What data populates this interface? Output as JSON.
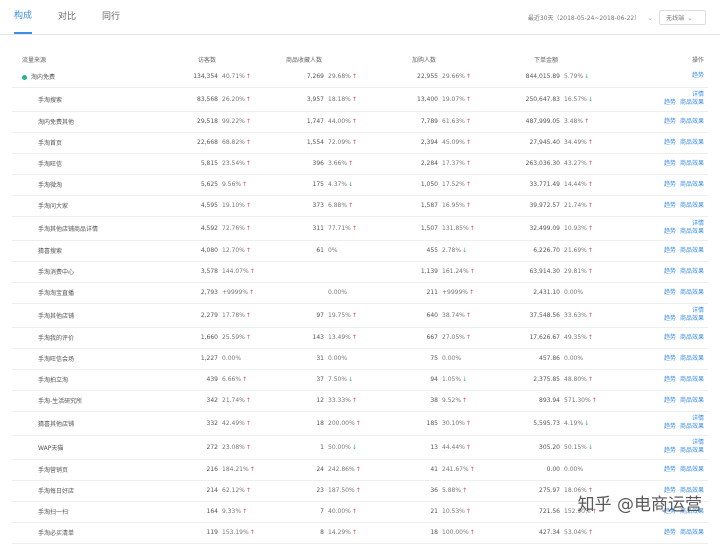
{
  "tabs": [
    "构成",
    "对比",
    "同行"
  ],
  "active_tab": 0,
  "date_range_label": "最近30天（2018-05-24~2018-06-22）",
  "terminal_label": "无线端",
  "columns": [
    "流量来源",
    "访客数",
    "商品收藏人数",
    "加购人数",
    "下单金额",
    "操作"
  ],
  "rows": [
    {
      "name": "淘内免费",
      "level": 0,
      "dot": true,
      "c1": "134,354",
      "p1": "40.71%",
      "t1": "up",
      "c2": "7,269",
      "p2": "29.68%",
      "t2": "up",
      "c3": "22,955",
      "p3": "29.66%",
      "t3": "up",
      "c4": "844,015.89",
      "p4": "5.79%",
      "t4": "down",
      "ops": [
        "趋势"
      ]
    },
    {
      "name": "手淘搜索",
      "level": 1,
      "c1": "83,568",
      "p1": "26.20%",
      "t1": "up",
      "c2": "3,957",
      "p2": "18.18%",
      "t2": "up",
      "c3": "13,400",
      "p3": "19.07%",
      "t3": "up",
      "c4": "250,647.83",
      "p4": "16.57%",
      "t4": "down",
      "ops": [
        "详情",
        "趋势",
        "商品效果"
      ]
    },
    {
      "name": "淘内免费其他",
      "level": 1,
      "c1": "29,518",
      "p1": "99.22%",
      "t1": "up",
      "c2": "1,747",
      "p2": "44.00%",
      "t2": "up",
      "c3": "7,789",
      "p3": "61.63%",
      "t3": "up",
      "c4": "487,999.05",
      "p4": "3.48%",
      "t4": "up",
      "ops": [
        "趋势",
        "商品效果"
      ]
    },
    {
      "name": "手淘首页",
      "level": 1,
      "c1": "22,668",
      "p1": "68.82%",
      "t1": "up",
      "c2": "1,554",
      "p2": "72.09%",
      "t2": "up",
      "c3": "2,394",
      "p3": "45.09%",
      "t3": "up",
      "c4": "27,945.40",
      "p4": "34.49%",
      "t4": "up",
      "ops": [
        "趋势",
        "商品效果"
      ]
    },
    {
      "name": "手淘旺信",
      "level": 1,
      "c1": "5,815",
      "p1": "23.54%",
      "t1": "up",
      "c2": "396",
      "p2": "3.66%",
      "t2": "up",
      "c3": "2,284",
      "p3": "17.37%",
      "t3": "up",
      "c4": "263,036.30",
      "p4": "43.27%",
      "t4": "up",
      "ops": [
        "趋势",
        "商品效果"
      ]
    },
    {
      "name": "手淘微淘",
      "level": 1,
      "c1": "5,625",
      "p1": "9.56%",
      "t1": "up",
      "c2": "175",
      "p2": "4.37%",
      "t2": "down",
      "c3": "1,050",
      "p3": "17.52%",
      "t3": "up",
      "c4": "33,771.49",
      "p4": "14.44%",
      "t4": "up",
      "ops": [
        "趋势",
        "商品效果"
      ]
    },
    {
      "name": "手淘问大家",
      "level": 1,
      "c1": "4,595",
      "p1": "19.10%",
      "t1": "up",
      "c2": "373",
      "p2": "6.88%",
      "t2": "up",
      "c3": "1,587",
      "p3": "16.95%",
      "t3": "up",
      "c4": "39,972.57",
      "p4": "21.74%",
      "t4": "up",
      "ops": [
        "趋势",
        "商品效果"
      ]
    },
    {
      "name": "手淘其他店铺商品详情",
      "level": 1,
      "c1": "4,592",
      "p1": "72.76%",
      "t1": "up",
      "c2": "311",
      "p2": "77.71%",
      "t2": "up",
      "c3": "1,507",
      "p3": "131.85%",
      "t3": "up",
      "c4": "32,499.09",
      "p4": "10.93%",
      "t4": "up",
      "ops": [
        "详情",
        "趋势",
        "商品效果"
      ]
    },
    {
      "name": "猜喜搜索",
      "level": 1,
      "c1": "4,080",
      "p1": "12.70%",
      "t1": "up",
      "c2": "61",
      "p2": "0%",
      "t2": "none",
      "c3": "455",
      "p3": "2.78%",
      "t3": "down",
      "c4": "6,226.70",
      "p4": "21.69%",
      "t4": "up",
      "ops": [
        "趋势",
        "商品效果"
      ]
    },
    {
      "name": "手淘消费中心",
      "level": 1,
      "c1": "3,578",
      "p1": "144.07%",
      "t1": "up",
      "c2": "",
      "p2": "",
      "t2": "none",
      "c3": "1,139",
      "p3": "161.24%",
      "t3": "up",
      "c4": "63,914.30",
      "p4": "29.81%",
      "t4": "up",
      "ops": [
        "趋势",
        "商品效果"
      ]
    },
    {
      "name": "手淘淘宝直播",
      "level": 1,
      "c1": "2,793",
      "p1": "+9999%",
      "t1": "up",
      "c2": "",
      "p2": "0.00%",
      "t2": "none",
      "c3": "211",
      "p3": "+9999%",
      "t3": "up",
      "c4": "2,431.10",
      "p4": "0.00%",
      "t4": "none",
      "ops": [
        "趋势",
        "商品效果"
      ]
    },
    {
      "name": "手淘其他店铺",
      "level": 1,
      "c1": "2,279",
      "p1": "17.78%",
      "t1": "up",
      "c2": "97",
      "p2": "19.75%",
      "t2": "up",
      "c3": "640",
      "p3": "38.74%",
      "t3": "up",
      "c4": "37,548.56",
      "p4": "33.63%",
      "t4": "up",
      "ops": [
        "详情",
        "趋势",
        "商品效果"
      ]
    },
    {
      "name": "手淘我的评价",
      "level": 1,
      "c1": "1,660",
      "p1": "25.59%",
      "t1": "up",
      "c2": "143",
      "p2": "13.49%",
      "t2": "up",
      "c3": "667",
      "p3": "27.05%",
      "t3": "up",
      "c4": "17,626.67",
      "p4": "49.35%",
      "t4": "up",
      "ops": [
        "趋势",
        "商品效果"
      ]
    },
    {
      "name": "手淘旺信会场",
      "level": 1,
      "c1": "1,227",
      "p1": "0.00%",
      "t1": "none",
      "c2": "31",
      "p2": "0.00%",
      "t2": "none",
      "c3": "75",
      "p3": "0.00%",
      "t3": "none",
      "c4": "457.86",
      "p4": "0.00%",
      "t4": "none",
      "ops": [
        "趋势",
        "商品效果"
      ]
    },
    {
      "name": "手淘拍立淘",
      "level": 1,
      "c1": "439",
      "p1": "6.66%",
      "t1": "up",
      "c2": "37",
      "p2": "7.50%",
      "t2": "down",
      "c3": "94",
      "p3": "1.05%",
      "t3": "down",
      "c4": "2,375.85",
      "p4": "48.80%",
      "t4": "up",
      "ops": [
        "趋势",
        "商品效果"
      ]
    },
    {
      "name": "手淘-生活研究所",
      "level": 1,
      "c1": "342",
      "p1": "21.74%",
      "t1": "up",
      "c2": "12",
      "p2": "33.33%",
      "t2": "up",
      "c3": "38",
      "p3": "9.52%",
      "t3": "up",
      "c4": "893.94",
      "p4": "571.30%",
      "t4": "up",
      "ops": [
        "趋势",
        "商品效果"
      ]
    },
    {
      "name": "猜喜其他店铺",
      "level": 1,
      "c1": "332",
      "p1": "42.49%",
      "t1": "up",
      "c2": "18",
      "p2": "200.00%",
      "t2": "up",
      "c3": "185",
      "p3": "30.10%",
      "t3": "up",
      "c4": "5,595.73",
      "p4": "4.19%",
      "t4": "down",
      "ops": [
        "详情",
        "趋势",
        "商品效果"
      ]
    },
    {
      "name": "WAP天猫",
      "level": 1,
      "c1": "272",
      "p1": "23.08%",
      "t1": "up",
      "c2": "1",
      "p2": "50.00%",
      "t2": "down",
      "c3": "13",
      "p3": "44.44%",
      "t3": "up",
      "c4": "305.20",
      "p4": "50.15%",
      "t4": "down",
      "ops": [
        "详情",
        "趋势",
        "商品效果"
      ]
    },
    {
      "name": "手淘营销页",
      "level": 1,
      "c1": "216",
      "p1": "184.21%",
      "t1": "up",
      "c2": "24",
      "p2": "242.86%",
      "t2": "up",
      "c3": "41",
      "p3": "241.67%",
      "t3": "up",
      "c4": "0.00",
      "p4": "0.00%",
      "t4": "none",
      "ops": [
        "趋势",
        "商品效果"
      ]
    },
    {
      "name": "手淘每日好店",
      "level": 1,
      "c1": "214",
      "p1": "62.12%",
      "t1": "up",
      "c2": "23",
      "p2": "187.50%",
      "t2": "up",
      "c3": "36",
      "p3": "5.88%",
      "t3": "up",
      "c4": "275.97",
      "p4": "18.06%",
      "t4": "up",
      "ops": [
        "趋势",
        "商品效果"
      ]
    },
    {
      "name": "手淘扫一扫",
      "level": 1,
      "c1": "164",
      "p1": "9.33%",
      "t1": "up",
      "c2": "7",
      "p2": "40.00%",
      "t2": "up",
      "c3": "21",
      "p3": "10.53%",
      "t3": "up",
      "c4": "721.56",
      "p4": "152.90%",
      "t4": "up",
      "ops": [
        "趋势",
        "商品效果"
      ]
    },
    {
      "name": "手淘必买清单",
      "level": 1,
      "c1": "119",
      "p1": "153.19%",
      "t1": "up",
      "c2": "8",
      "p2": "14.29%",
      "t2": "up",
      "c3": "18",
      "p3": "100.00%",
      "t3": "up",
      "c4": "427.34",
      "p4": "53.04%",
      "t4": "up",
      "ops": [
        "趋势",
        "商品效果"
      ]
    }
  ],
  "watermark": "知乎 @电商运营",
  "colors": {
    "accent": "#3a8ee6",
    "up": "#e04646",
    "down": "#3bb27c",
    "dot": "#28b38a"
  }
}
